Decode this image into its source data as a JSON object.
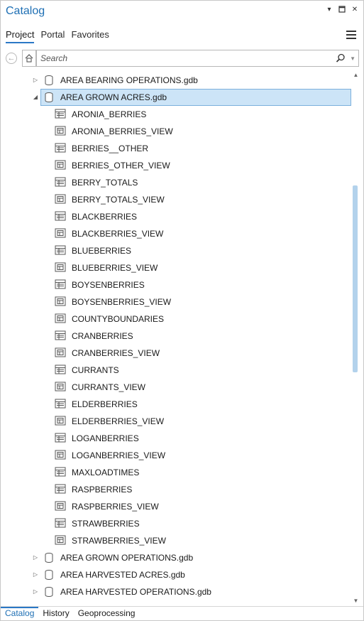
{
  "window": {
    "title": "Catalog"
  },
  "tabs": [
    {
      "label": "Project",
      "active": true
    },
    {
      "label": "Portal",
      "active": false
    },
    {
      "label": "Favorites",
      "active": false
    }
  ],
  "search": {
    "placeholder": "Search"
  },
  "tree": [
    {
      "label": "AREA BEARING OPERATIONS.gdb",
      "type": "gdb",
      "level": 0,
      "arrow": "collapsed"
    },
    {
      "label": "AREA GROWN ACRES.gdb",
      "type": "gdb",
      "level": 0,
      "arrow": "expanded",
      "selected": true
    },
    {
      "label": "ARONIA_BERRIES",
      "type": "table",
      "level": 1
    },
    {
      "label": "ARONIA_BERRIES_VIEW",
      "type": "view",
      "level": 1
    },
    {
      "label": "BERRIES__OTHER",
      "type": "table",
      "level": 1
    },
    {
      "label": "BERRIES_OTHER_VIEW",
      "type": "view",
      "level": 1
    },
    {
      "label": "BERRY_TOTALS",
      "type": "table",
      "level": 1
    },
    {
      "label": "BERRY_TOTALS_VIEW",
      "type": "view",
      "level": 1
    },
    {
      "label": "BLACKBERRIES",
      "type": "table",
      "level": 1
    },
    {
      "label": "BLACKBERRIES_VIEW",
      "type": "view",
      "level": 1
    },
    {
      "label": "BLUEBERRIES",
      "type": "table",
      "level": 1
    },
    {
      "label": "BLUEBERRIES_VIEW",
      "type": "view",
      "level": 1
    },
    {
      "label": "BOYSENBERRIES",
      "type": "table",
      "level": 1
    },
    {
      "label": "BOYSENBERRIES_VIEW",
      "type": "view",
      "level": 1
    },
    {
      "label": "COUNTYBOUNDARIES",
      "type": "view",
      "level": 1
    },
    {
      "label": "CRANBERRIES",
      "type": "table",
      "level": 1
    },
    {
      "label": "CRANBERRIES_VIEW",
      "type": "view",
      "level": 1
    },
    {
      "label": "CURRANTS",
      "type": "table",
      "level": 1
    },
    {
      "label": "CURRANTS_VIEW",
      "type": "view",
      "level": 1
    },
    {
      "label": "ELDERBERRIES",
      "type": "table",
      "level": 1
    },
    {
      "label": "ELDERBERRIES_VIEW",
      "type": "view",
      "level": 1
    },
    {
      "label": "LOGANBERRIES",
      "type": "table",
      "level": 1
    },
    {
      "label": "LOGANBERRIES_VIEW",
      "type": "view",
      "level": 1
    },
    {
      "label": "MAXLOADTIMES",
      "type": "table",
      "level": 1
    },
    {
      "label": "RASPBERRIES",
      "type": "table",
      "level": 1
    },
    {
      "label": "RASPBERRIES_VIEW",
      "type": "view",
      "level": 1
    },
    {
      "label": "STRAWBERRIES",
      "type": "table",
      "level": 1
    },
    {
      "label": "STRAWBERRIES_VIEW",
      "type": "view",
      "level": 1
    },
    {
      "label": "AREA GROWN OPERATIONS.gdb",
      "type": "gdb",
      "level": 0,
      "arrow": "collapsed"
    },
    {
      "label": "AREA HARVESTED ACRES.gdb",
      "type": "gdb",
      "level": 0,
      "arrow": "collapsed"
    },
    {
      "label": "AREA HARVESTED OPERATIONS.gdb",
      "type": "gdb",
      "level": 0,
      "arrow": "collapsed"
    }
  ],
  "bottom_tabs": [
    {
      "label": "Catalog",
      "active": true
    },
    {
      "label": "History",
      "active": false
    },
    {
      "label": "Geoprocessing",
      "active": false
    }
  ],
  "colors": {
    "accent": "#1e6fb4",
    "selection": "#cce4f7",
    "scroll_thumb": "#b3d2ec"
  }
}
